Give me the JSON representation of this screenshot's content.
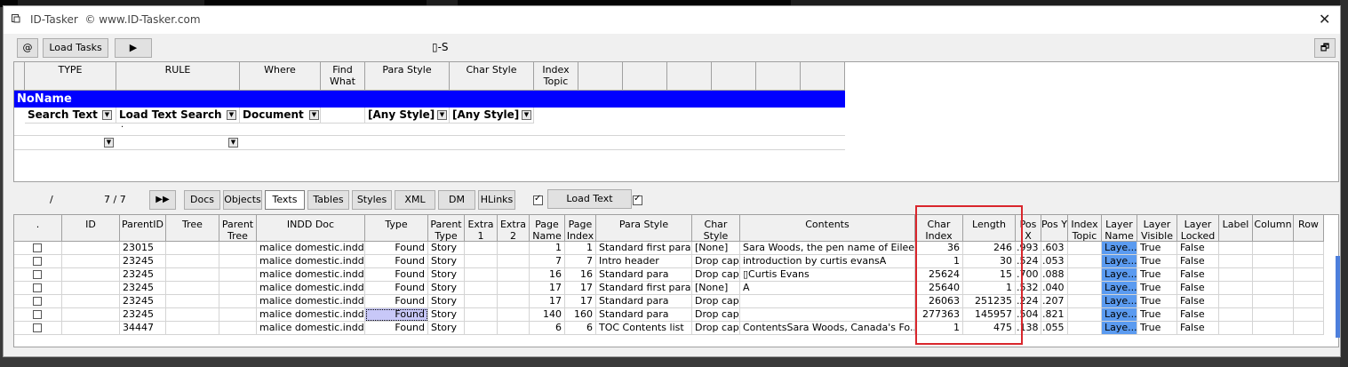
{
  "window": {
    "title": "ID-Tasker",
    "subtitle": "© www.ID-Tasker.com",
    "center_label": "▯-S"
  },
  "toolbar": {
    "at_label": "@",
    "load_tasks_label": "Load Tasks",
    "play_label": "▶",
    "restore_label": "🗗"
  },
  "rules_grid": {
    "headers": [
      "TYPE",
      "RULE",
      "Where",
      "Find What",
      "Para Style",
      "Char Style",
      "Index Topic",
      "",
      "",
      "",
      "",
      "",
      ""
    ],
    "group_name": "NoName",
    "row1": {
      "type": "Search Text",
      "rule": "Load Text Search",
      "where": "Document",
      "find": "",
      "para": "[Any Style]",
      "char": "[Any Style]"
    },
    "row2_marker": "."
  },
  "nav": {
    "slash": "/",
    "count": "7 / 7",
    "ff_label": "▶▶"
  },
  "tabs": [
    "Docs",
    "Objects",
    "Texts",
    "Tables",
    "Styles",
    "XML",
    "DM",
    "HLinks"
  ],
  "load_text_label": "Load Text",
  "results": {
    "headers": [
      ".",
      "ID",
      "ParentID",
      "Tree",
      "Parent Tree",
      "INDD Doc",
      "Type",
      "Parent Type",
      "Extra 1",
      "Extra 2",
      "Page Name",
      "Page Index",
      "Para Style",
      "Char Style",
      "Contents",
      "Char Index",
      "Length",
      "Pos X",
      "Pos Y",
      "Index Topic",
      "Layer Name",
      "Layer Visible",
      "Layer Locked",
      "Label",
      "Column",
      "Row"
    ],
    "rows": [
      {
        "parentid": "23015",
        "doc": "malice domestic.indd",
        "type": "Found",
        "ptype": "Story",
        "pname": "1",
        "pindex": "1",
        "para": "Standard first para",
        "char": "[None]",
        "contents": "Sara Woods, the pen name of Eilee...",
        "cindex": "36",
        "length": "246",
        "posx": ".993",
        "posy": ".603",
        "layer": "Laye...",
        "visible": "True",
        "locked": "False"
      },
      {
        "parentid": "23245",
        "doc": "malice domestic.indd",
        "type": "Found",
        "ptype": "Story",
        "pname": "7",
        "pindex": "7",
        "para": "Intro header",
        "char": "Drop cap",
        "contents": "introduction by curtis evansA",
        "cindex": "1",
        "length": "30",
        "posx": ".524",
        "posy": ".053",
        "layer": "Laye...",
        "visible": "True",
        "locked": "False"
      },
      {
        "parentid": "23245",
        "doc": "malice domestic.indd",
        "type": "Found",
        "ptype": "Story",
        "pname": "16",
        "pindex": "16",
        "para": "Standard para",
        "char": "Drop cap",
        "contents": "▯Curtis Evans",
        "cindex": "25624",
        "length": "15",
        "posx": ".700",
        "posy": ".088",
        "layer": "Laye...",
        "visible": "True",
        "locked": "False"
      },
      {
        "parentid": "23245",
        "doc": "malice domestic.indd",
        "type": "Found",
        "ptype": "Story",
        "pname": "17",
        "pindex": "17",
        "para": "Standard first para",
        "char": "[None]",
        "contents": "A",
        "cindex": "25640",
        "length": "1",
        "posx": ".532",
        "posy": ".040",
        "layer": "Laye...",
        "visible": "True",
        "locked": "False"
      },
      {
        "parentid": "23245",
        "doc": "malice domestic.indd",
        "type": "Found",
        "ptype": "Story",
        "pname": "17",
        "pindex": "17",
        "para": "Standard para",
        "char": "Drop cap",
        "contents": "",
        "cindex": "26063",
        "length": "251235",
        "posx": ".224",
        "posy": ".207",
        "layer": "Laye...",
        "visible": "True",
        "locked": "False"
      },
      {
        "parentid": "23245",
        "doc": "malice domestic.indd",
        "type": "Found",
        "ptype": "Story",
        "pname": "140",
        "pindex": "160",
        "para": "Standard para",
        "char": "Drop cap",
        "contents": "",
        "cindex": "277363",
        "length": "145957",
        "posx": ".504",
        "posy": ".821",
        "layer": "Laye...",
        "visible": "True",
        "locked": "False"
      },
      {
        "parentid": "34447",
        "doc": "malice domestic.indd",
        "type": "Found",
        "ptype": "Story",
        "pname": "6",
        "pindex": "6",
        "para": "TOC Contents list",
        "char": "Drop cap",
        "contents": "ContentsSara Woods, Canada's Fo...",
        "cindex": "1",
        "length": "475",
        "posx": ".138",
        "posy": ".055",
        "layer": "Laye...",
        "visible": "True",
        "locked": "False"
      }
    ]
  },
  "colors": {
    "group_bar": "#0000ff",
    "layer_cell": "#5b9bf0",
    "highlight": "#d9262c"
  }
}
